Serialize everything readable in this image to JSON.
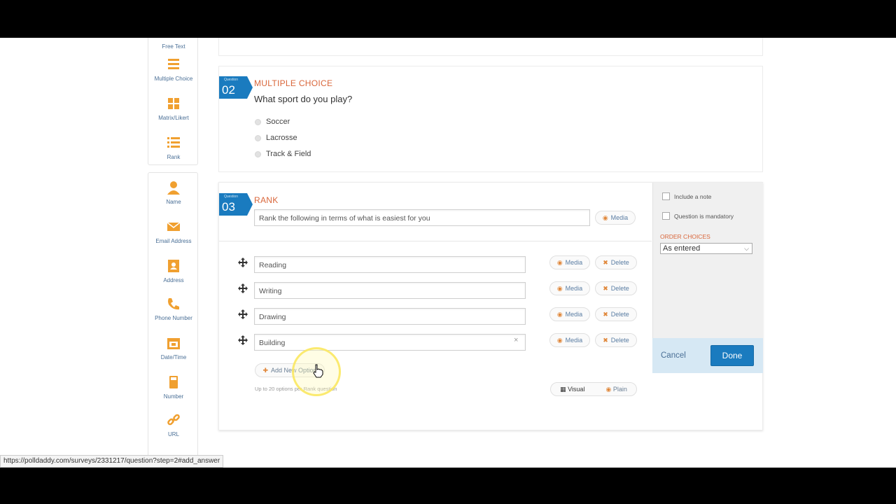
{
  "browser": {
    "status_url": "https://polldaddy.com/surveys/2331217/question?step=2#add_answer"
  },
  "toolbox": {
    "group1": [
      {
        "label": "Free Text",
        "icon": "free-text-icon"
      },
      {
        "label": "Multiple Choice",
        "icon": "list-icon"
      },
      {
        "label": "Matrix/Likert",
        "icon": "grid-icon"
      },
      {
        "label": "Rank",
        "icon": "rank-icon"
      }
    ],
    "group2": [
      {
        "label": "Name",
        "icon": "person-icon"
      },
      {
        "label": "Email Address",
        "icon": "envelope-icon"
      },
      {
        "label": "Address",
        "icon": "address-book-icon"
      },
      {
        "label": "Phone Number",
        "icon": "phone-icon"
      },
      {
        "label": "Date/Time",
        "icon": "calendar-icon"
      },
      {
        "label": "Number",
        "icon": "calculator-icon"
      },
      {
        "label": "URL",
        "icon": "link-icon"
      }
    ]
  },
  "q2": {
    "badge_small": "Question",
    "number": "02",
    "type": "MULTIPLE CHOICE",
    "text": "What sport do you play?",
    "choices": [
      "Soccer",
      "Lacrosse",
      "Track & Field"
    ]
  },
  "q3": {
    "badge_small": "Question",
    "number": "03",
    "type": "RANK",
    "question_value": "Rank the following in terms of what is easiest for you",
    "media_label": "Media",
    "options": [
      {
        "value": "Reading",
        "media": "Media",
        "delete": "Delete"
      },
      {
        "value": "Writing",
        "media": "Media",
        "delete": "Delete"
      },
      {
        "value": "Drawing",
        "media": "Media",
        "delete": "Delete"
      },
      {
        "value": "Building",
        "media": "Media",
        "delete": "Delete"
      }
    ],
    "add_option_label": "Add New Option",
    "limit_note": "Up to 20 options per Rank question",
    "visual_label": "Visual",
    "plain_label": "Plain"
  },
  "settings": {
    "include_note": "Include a note",
    "mandatory": "Question is mandatory",
    "order_label": "ORDER CHOICES",
    "order_value": "As entered",
    "cancel": "Cancel",
    "done": "Done"
  },
  "colors": {
    "accent": "#1a7bbf",
    "type_label": "#d9663a",
    "link": "#4a6f96"
  }
}
